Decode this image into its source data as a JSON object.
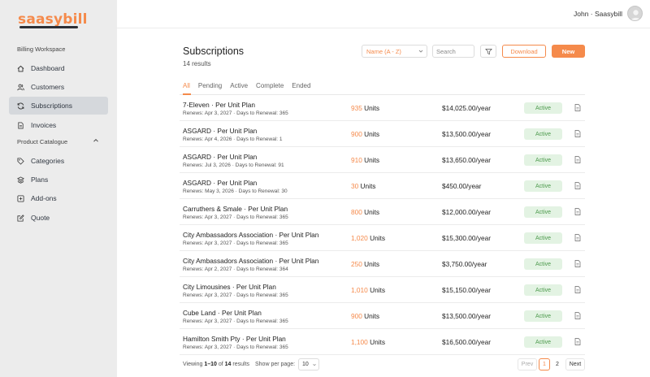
{
  "app": {
    "logo_text": "saasybill"
  },
  "sidebar": {
    "workspace_label": "Billing Workspace",
    "items": [
      {
        "label": "Dashboard",
        "icon": "dashboard-icon"
      },
      {
        "label": "Customers",
        "icon": "users-icon"
      },
      {
        "label": "Subscriptions",
        "icon": "subscriptions-icon",
        "active": true
      },
      {
        "label": "Invoices",
        "icon": "invoice-icon"
      }
    ],
    "catalogue_label": "Product Catalogue",
    "catalogue_items": [
      {
        "label": "Categories",
        "icon": "tag-icon"
      },
      {
        "label": "Plans",
        "icon": "plans-icon"
      },
      {
        "label": "Add-ons",
        "icon": "plus-square-icon"
      },
      {
        "label": "Quote",
        "icon": "edit-icon"
      }
    ]
  },
  "header": {
    "user": "John · Saasybill"
  },
  "page": {
    "title": "Subscriptions",
    "results": "14 results",
    "sort_value": "Name (A - Z)",
    "search_placeholder": "Search",
    "download_label": "Download",
    "new_label": "New"
  },
  "tabs": [
    "All",
    "Pending",
    "Active",
    "Complete",
    "Ended"
  ],
  "rows": [
    {
      "name": "7-Eleven  ·  Per Unit Plan",
      "meta": "Renews: Apr 3, 2027  ·  Days to Renewal: 365",
      "units_num": "935",
      "units_label": " Units",
      "price": "$14,025.00/year",
      "status": "Active"
    },
    {
      "name": "ASGARD  ·  Per Unit Plan",
      "meta": "Renews: Apr 4, 2026  ·  Days to Renewal: 1",
      "units_num": "900",
      "units_label": " Units",
      "price": "$13,500.00/year",
      "status": "Active"
    },
    {
      "name": "ASGARD  ·  Per Unit Plan",
      "meta": "Renews: Jul 3, 2026  ·  Days to Renewal: 91",
      "units_num": "910",
      "units_label": " Units",
      "price": "$13,650.00/year",
      "status": "Active"
    },
    {
      "name": "ASGARD  ·  Per Unit Plan",
      "meta": "Renews: May 3, 2026  ·  Days to Renewal: 30",
      "units_num": "30",
      "units_label": " Units",
      "price": "$450.00/year",
      "status": "Active"
    },
    {
      "name": "Carruthers & Smale  ·  Per Unit Plan",
      "meta": "Renews: Apr 3, 2027  ·  Days to Renewal: 365",
      "units_num": "800",
      "units_label": " Units",
      "price": "$12,000.00/year",
      "status": "Active"
    },
    {
      "name": "City Ambassadors Association  ·  Per Unit Plan",
      "meta": "Renews: Apr 3, 2027  ·  Days to Renewal: 365",
      "units_num": "1,020",
      "units_label": " Units",
      "price": "$15,300.00/year",
      "status": "Active"
    },
    {
      "name": "City Ambassadors Association  ·  Per Unit Plan",
      "meta": "Renews: Apr 2, 2027  ·  Days to Renewal: 364",
      "units_num": "250",
      "units_label": " Units",
      "price": "$3,750.00/year",
      "status": "Active"
    },
    {
      "name": "City Limousines  ·  Per Unit Plan",
      "meta": "Renews: Apr 3, 2027  ·  Days to Renewal: 365",
      "units_num": "1,010",
      "units_label": " Units",
      "price": "$15,150.00/year",
      "status": "Active"
    },
    {
      "name": "Cube Land  ·  Per Unit Plan",
      "meta": "Renews: Apr 3, 2027  ·  Days to Renewal: 365",
      "units_num": "900",
      "units_label": " Units",
      "price": "$13,500.00/year",
      "status": "Active"
    },
    {
      "name": "Hamilton Smith Pty  ·  Per Unit Plan",
      "meta": "Renews: Apr 3, 2027  ·  Days to Renewal: 365",
      "units_num": "1,100",
      "units_label": " Units",
      "price": "$16,500.00/year",
      "status": "Active"
    }
  ],
  "footer": {
    "viewing_prefix": "Viewing ",
    "viewing_range": "1–10",
    "viewing_of": " of ",
    "viewing_total": "14",
    "viewing_suffix": " results",
    "per_page_label": "Show per page:",
    "per_page_value": "10",
    "prev": "Prev",
    "pages": [
      "1",
      "2"
    ],
    "next": "Next"
  },
  "colors": {
    "accent": "#f58a4b",
    "active_badge_bg": "#e3f3e3",
    "active_badge_text": "#4d9a4d",
    "sidebar_bg": "#ececec"
  }
}
